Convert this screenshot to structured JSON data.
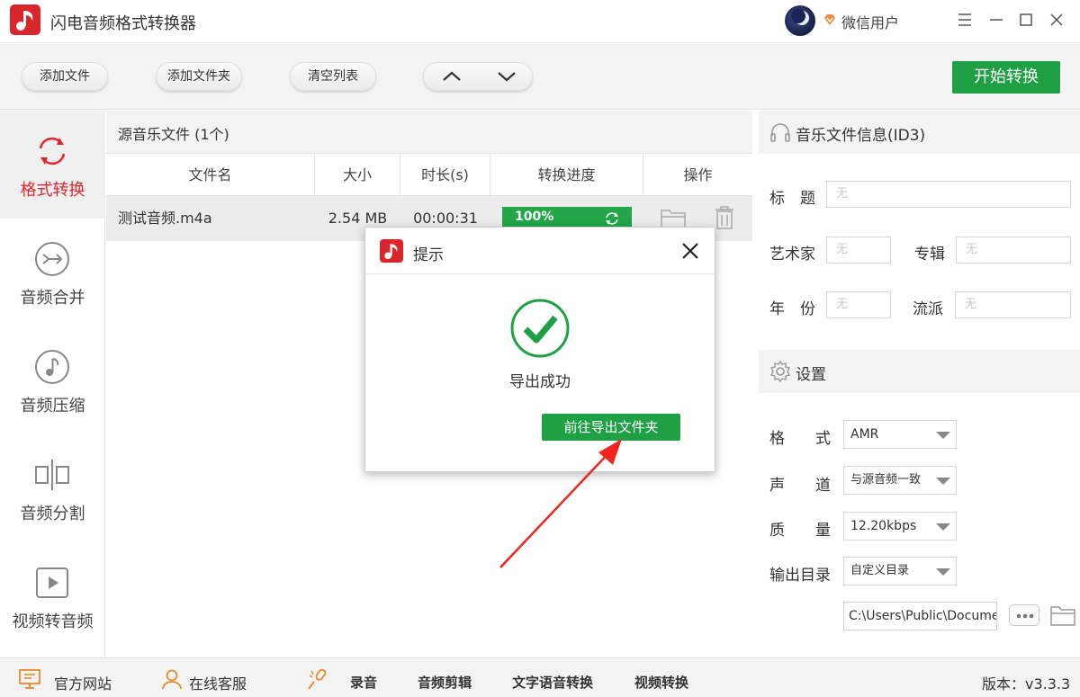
{
  "app": {
    "title": "闪电音频格式转换器",
    "user_name": "微信用户"
  },
  "toolbar": {
    "add_file": "添加文件",
    "add_folder": "添加文件夹",
    "clear_list": "清空列表",
    "start_convert": "开始转换"
  },
  "sidebar": {
    "items": [
      {
        "label": "格式转换",
        "icon": "refresh-icon",
        "active": true
      },
      {
        "label": "音频合并",
        "icon": "merge-icon",
        "active": false
      },
      {
        "label": "音频压缩",
        "icon": "music-note-icon",
        "active": false
      },
      {
        "label": "音频分割",
        "icon": "split-icon",
        "active": false
      },
      {
        "label": "视频转音频",
        "icon": "play-icon",
        "active": false
      }
    ]
  },
  "file_list": {
    "caption": "源音乐文件 (1个)",
    "columns": [
      "文件名",
      "大小",
      "时长(s)",
      "转换进度",
      "操作"
    ],
    "rows": [
      {
        "name": "测试音频.m4a",
        "size": "2.54 MB",
        "duration": "00:00:31",
        "progress_label": "100%",
        "progress": 1.0
      }
    ]
  },
  "id3": {
    "header": "音乐文件信息(ID3)",
    "title_label": "标　题",
    "title_value": "无",
    "artist_label": "艺术家",
    "artist_value": "无",
    "album_label": "专辑",
    "album_value": "无",
    "year_label": "年　份",
    "year_value": "无",
    "genre_label": "流派",
    "genre_value": "无"
  },
  "settings": {
    "header": "设置",
    "format_label": "格　　式",
    "format_value": "AMR",
    "channel_label": "声　　道",
    "channel_value": "与源音频一致",
    "quality_label": "质　　量",
    "quality_value": "12.20kbps",
    "output_label": "输出目录",
    "output_value": "自定义目录",
    "output_path": "C:\\Users\\Public\\Documents"
  },
  "bottom": {
    "site": "官方网站",
    "service": "在线客服",
    "record": "录音",
    "edit": "音频剪辑",
    "tts": "文字语音转换",
    "video": "视频转换",
    "version": "版本：v3.3.3"
  },
  "dialog": {
    "title": "提示",
    "message": "导出成功",
    "go_button": "前往导出文件夹"
  },
  "colors": {
    "accent_green": "#1fa045",
    "brand_red": "#d9262c",
    "annotation_red": "#f0261e"
  }
}
